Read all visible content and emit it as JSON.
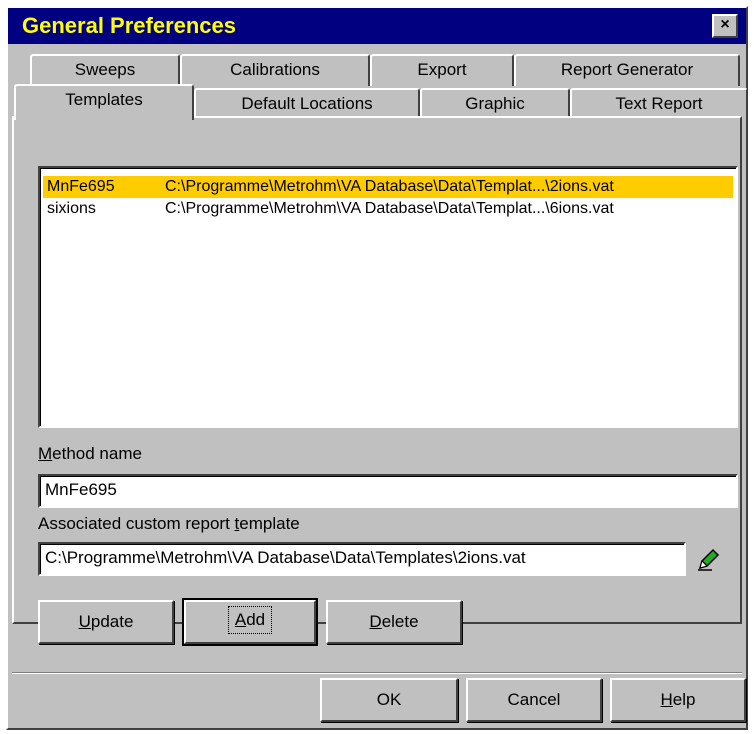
{
  "window": {
    "title": "General Preferences",
    "close_glyph": "×"
  },
  "tabs_back": [
    {
      "label": "Sweeps"
    },
    {
      "label": "Calibrations"
    },
    {
      "label": "Export"
    },
    {
      "label": "Report Generator"
    }
  ],
  "tabs_front": [
    {
      "label": "Templates",
      "active": true
    },
    {
      "label": "Default Locations"
    },
    {
      "label": "Graphic"
    },
    {
      "label": "Text Report"
    }
  ],
  "templates": [
    {
      "name": "MnFe695",
      "path": "C:\\Programme\\Metrohm\\VA Database\\Data\\Templat...\\2ions.vat",
      "selected": true
    },
    {
      "name": "sixions",
      "path": "C:\\Programme\\Metrohm\\VA Database\\Data\\Templat...\\6ions.vat",
      "selected": false
    }
  ],
  "method_name": {
    "label_first": "M",
    "label_rest": "ethod name",
    "value": "MnFe695"
  },
  "report_template": {
    "label_before": "Associated custom report ",
    "label_accel": "t",
    "label_after": "emplate",
    "value": "C:\\Programme\\Metrohm\\VA Database\\Data\\Templates\\2ions.vat",
    "edit_icon": "pencil-icon"
  },
  "buttons": {
    "update": {
      "accel": "U",
      "rest": "pdate"
    },
    "add": {
      "accel": "A",
      "rest": "dd"
    },
    "delete": {
      "accel": "D",
      "rest": "elete"
    },
    "ok": "OK",
    "cancel": "Cancel",
    "help": {
      "accel": "H",
      "rest": "elp"
    }
  },
  "colors": {
    "titlebar_bg": "#000080",
    "title_text": "#ffff00",
    "selection": "#ffcc00",
    "face": "#c0c0c0"
  }
}
